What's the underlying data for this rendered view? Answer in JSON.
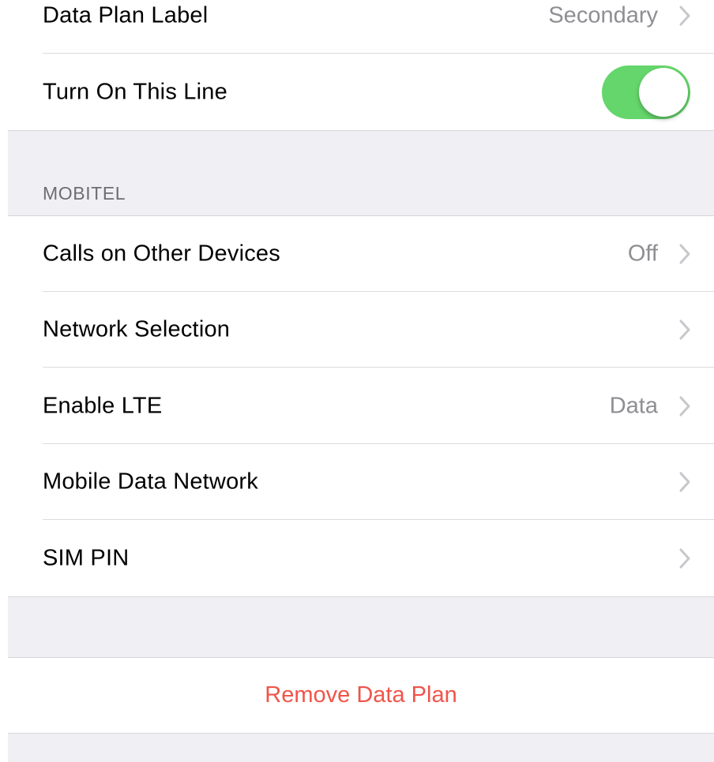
{
  "top_group": {
    "data_plan_label": {
      "label": "Data Plan Label",
      "value": "Secondary"
    },
    "turn_on_line": {
      "label": "Turn On This Line",
      "toggle_on": true
    }
  },
  "carrier_section": {
    "header": "MOBITEL",
    "rows": [
      {
        "label": "Calls on Other Devices",
        "value": "Off"
      },
      {
        "label": "Network Selection",
        "value": ""
      },
      {
        "label": "Enable LTE",
        "value": "Data"
      },
      {
        "label": "Mobile Data Network",
        "value": ""
      },
      {
        "label": "SIM PIN",
        "value": ""
      }
    ]
  },
  "remove": {
    "label": "Remove Data Plan"
  },
  "colors": {
    "background": "#efeff4",
    "toggle_on": "#65d66b",
    "destructive": "#f0544a",
    "secondary_text": "#8e8e93",
    "chevron": "#c7c7cc"
  },
  "icons": {
    "disclosure": "chevron-right-icon"
  }
}
